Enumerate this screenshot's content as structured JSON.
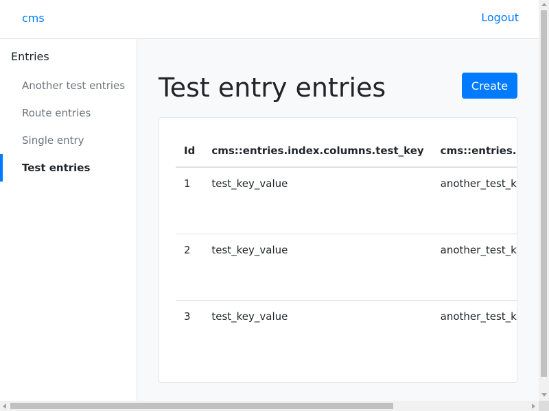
{
  "colors": {
    "accent": "#007bff",
    "text": "#212529",
    "muted": "#6c757d",
    "background": "#f8f9fa"
  },
  "header": {
    "brand": "cms",
    "logout_label": "Logout"
  },
  "sidebar": {
    "heading": "Entries",
    "items": [
      {
        "label": "Another test entries",
        "active": false
      },
      {
        "label": "Route entries",
        "active": false
      },
      {
        "label": "Single entry",
        "active": false
      },
      {
        "label": "Test entries",
        "active": true
      }
    ]
  },
  "main": {
    "title": "Test entry entries",
    "create_label": "Create",
    "table": {
      "columns": [
        "Id",
        "cms::entries.index.columns.test_key",
        "cms::entries.index.columns.another_test_key"
      ],
      "rows": [
        [
          "1",
          "test_key_value",
          "another_test_key_value"
        ],
        [
          "2",
          "test_key_value",
          "another_test_key_value"
        ],
        [
          "3",
          "test_key_value",
          "another_test_key_value"
        ]
      ]
    }
  },
  "scrollbars": {
    "vertical": "scrollbar",
    "horizontal": "scrollbar"
  }
}
